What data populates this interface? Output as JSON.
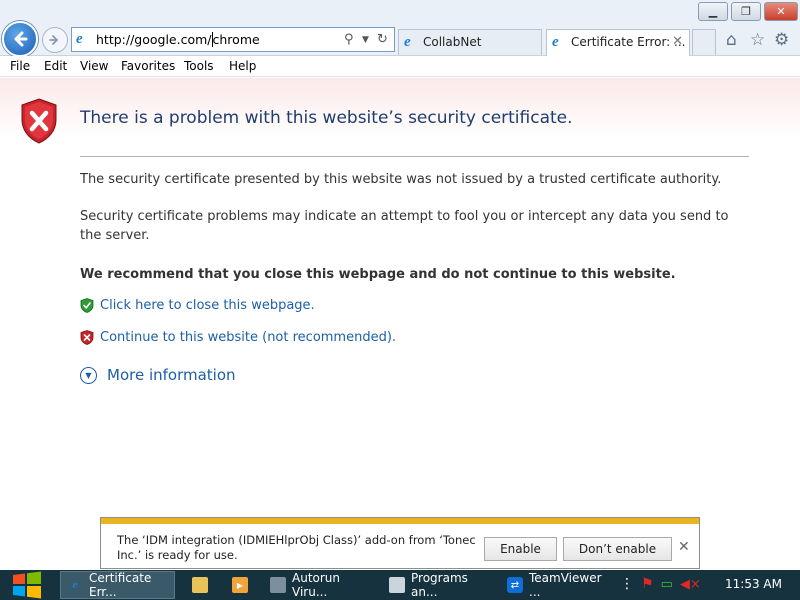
{
  "browser": {
    "address": {
      "url_before_cursor": "http://google.com/",
      "url_after_cursor": "chrome"
    },
    "tabs": [
      {
        "label": "CollabNet"
      },
      {
        "label": "Certificate Error: ...",
        "close": "✕"
      }
    ]
  },
  "menu": [
    "File",
    "Edit",
    "View",
    "Favorites",
    "Tools",
    "Help"
  ],
  "page": {
    "title": "There is a problem with this website’s security certificate.",
    "para1": "The security certificate presented by this website was not issued by a trusted certificate authority.",
    "para2": "Security certificate problems may indicate an attempt to fool you or intercept any data you send to the server.",
    "recommend": "We recommend that you close this webpage and do not continue to this website.",
    "close_link": "Click here to close this webpage.",
    "continue_link": "Continue to this website (not recommended).",
    "more_info": "More information"
  },
  "notification": {
    "text": "The ‘IDM integration (IDMIEHlprObj Class)’ add-on from ‘Tonec Inc.’ is ready for use.",
    "enable": "Enable",
    "dont_enable": "Don’t enable",
    "close": "✕"
  },
  "taskbar": {
    "items": [
      {
        "label": "Certificate Err..."
      },
      {
        "label": "Autorun Viru..."
      },
      {
        "label": "Programs an..."
      },
      {
        "label": "TeamViewer ..."
      }
    ],
    "clock": "11:53 AM"
  },
  "colors": {
    "accent_link": "#1c5fa8",
    "title": "#1f3d6e",
    "notification_stripe": "#e8b420",
    "taskbar": "#16323f"
  }
}
